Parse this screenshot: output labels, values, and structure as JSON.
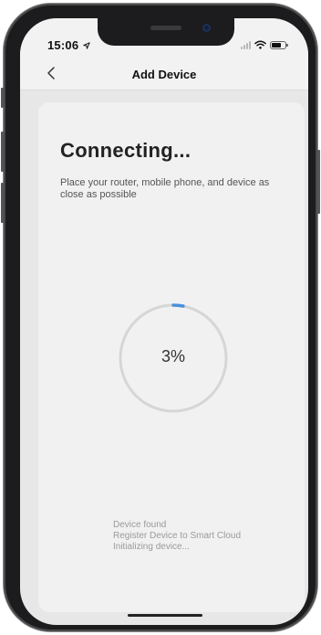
{
  "status_bar": {
    "time": "15:06",
    "location_icon": "location-arrow-icon",
    "signal_icon": "cellular-signal-icon",
    "wifi_icon": "wifi-icon",
    "battery_icon": "battery-icon"
  },
  "nav": {
    "back_icon": "chevron-left-icon",
    "title": "Add Device"
  },
  "main": {
    "heading": "Connecting...",
    "subtitle": "Place your router, mobile phone, and device as close as possible",
    "progress": {
      "value_percent": 3,
      "label": "3%",
      "accent_color": "#4a90d9",
      "track_color": "#d6d6d6"
    },
    "steps": [
      "Device found",
      "Register Device to Smart Cloud",
      "Initializing device..."
    ]
  }
}
